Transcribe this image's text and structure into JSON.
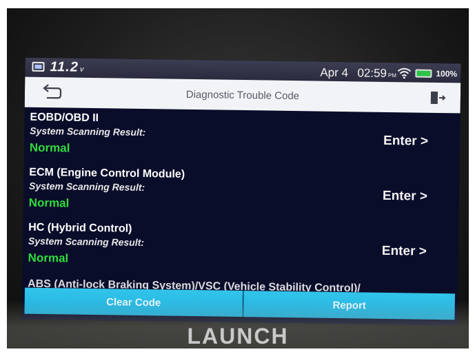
{
  "status_bar": {
    "voltage": "11.2",
    "voltage_unit": "v",
    "date": "Apr 4",
    "time": "02:59",
    "ampm": "PM",
    "battery_percent": "100%",
    "icons": [
      "battery-voltage-icon",
      "wifi-icon",
      "battery-icon"
    ]
  },
  "header": {
    "title": "Diagnostic Trouble Code",
    "back_icon": "back-arrow-icon",
    "exit_icon": "exit-icon"
  },
  "systems": [
    {
      "name": "EOBD/OBD II",
      "result_label": "System Scanning Result:",
      "status": "Normal",
      "action": "Enter >"
    },
    {
      "name": "ECM (Engine Control Module)",
      "result_label": "System Scanning Result:",
      "status": "Normal",
      "action": "Enter >"
    },
    {
      "name": "HC (Hybrid Control)",
      "result_label": "System Scanning Result:",
      "status": "Normal",
      "action": "Enter >"
    },
    {
      "name": "ABS (Anti-lock Braking System)/VSC (Vehicle Stability Control)/"
    }
  ],
  "buttons": {
    "clear": "Clear Code",
    "report": "Report"
  },
  "brand": "LAUNCH",
  "colors": {
    "screen_bg": "#0a0d2a",
    "status_normal": "#2fdc3c",
    "button": "#26b9e4"
  }
}
